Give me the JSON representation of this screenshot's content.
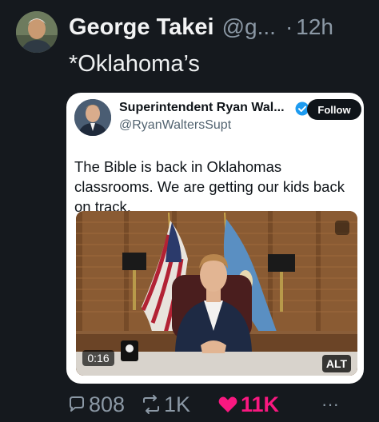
{
  "tweet": {
    "display_name": "George Takei",
    "handle": "@g...",
    "separator": "·",
    "time": "12h",
    "text": "*Oklahoma’s"
  },
  "quote": {
    "display_name": "Superintendent Ryan Wal...",
    "handle": "@RyanWaltersSupt",
    "follow_label": "Follow",
    "text": "The Bible is back in Oklahomas classrooms. We are getting our kids back on track.",
    "media": {
      "video_time": "0:16",
      "alt_label": "ALT"
    }
  },
  "actions": {
    "replies": "808",
    "reposts": "1K",
    "likes": "11K",
    "more": "···"
  },
  "colors": {
    "background": "#15191e",
    "like": "#f91880",
    "verified": "#1d9bf0"
  }
}
